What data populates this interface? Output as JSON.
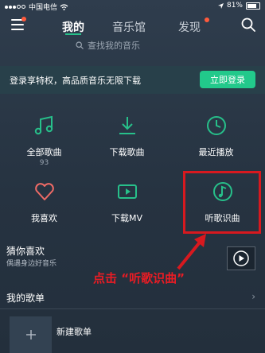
{
  "status_bar": {
    "carrier": "中国电信",
    "battery": "81%"
  },
  "header": {
    "tabs": [
      {
        "label": "我的"
      },
      {
        "label": "音乐馆"
      },
      {
        "label": "发现"
      }
    ],
    "search_placeholder": "查找我的音乐"
  },
  "banner": {
    "text": "登录享特权，高品质音乐无限下载",
    "button": "立即登录"
  },
  "grid": [
    {
      "label": "全部歌曲",
      "count": "93",
      "icon": "music-note-icon"
    },
    {
      "label": "下载歌曲",
      "icon": "download-icon"
    },
    {
      "label": "最近播放",
      "icon": "clock-icon"
    },
    {
      "label": "我喜欢",
      "icon": "heart-icon"
    },
    {
      "label": "下载MV",
      "icon": "video-icon"
    },
    {
      "label": "听歌识曲",
      "icon": "song-recognition-icon"
    }
  ],
  "guess": {
    "title": "猜你喜欢",
    "subtitle": "偶遇身边好音乐"
  },
  "annotation": "点击 “听歌识曲”",
  "my_playlists": {
    "title": "我的歌单",
    "new_playlist": "新建歌单"
  },
  "colors": {
    "accent": "#22c98b",
    "highlight": "#d7191f",
    "badge": "#ff5a3c"
  }
}
